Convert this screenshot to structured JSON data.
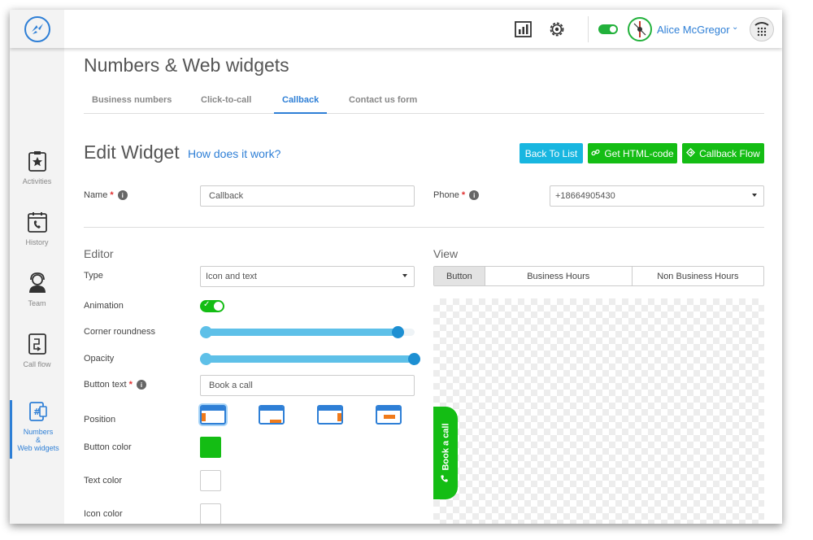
{
  "topbar": {
    "user_name": "Alice McGregor"
  },
  "sidebar": {
    "items": [
      {
        "label": "Activities"
      },
      {
        "label": "History"
      },
      {
        "label": "Team"
      },
      {
        "label": "Call flow"
      },
      {
        "label_line1": "Numbers",
        "label_line2": "&",
        "label_line3": "Web widgets"
      }
    ]
  },
  "page": {
    "title": "Numbers & Web widgets",
    "tabs": [
      {
        "label": "Business numbers"
      },
      {
        "label": "Click-to-call"
      },
      {
        "label": "Callback"
      },
      {
        "label": "Contact us form"
      }
    ],
    "active_tab": "Callback"
  },
  "edit": {
    "title": "Edit Widget",
    "help_link": "How does it work?",
    "back_button": "Back To List",
    "html_button": "Get HTML-code",
    "flow_button": "Callback Flow",
    "name_label": "Name",
    "name_value": "Callback",
    "phone_label": "Phone",
    "phone_value": "+18664905430",
    "required_mark": "*",
    "info_mark": "i"
  },
  "editor": {
    "title": "Editor",
    "type_label": "Type",
    "type_value": "Icon and text",
    "animation_label": "Animation",
    "animation_enabled": true,
    "corner_label": "Corner roundness",
    "corner_value": 0.92,
    "opacity_label": "Opacity",
    "opacity_value": 1.0,
    "button_text_label": "Button text",
    "button_text_value": "Book a call",
    "position_label": "Position",
    "position_selected": "left-middle",
    "button_color_label": "Button color",
    "button_color": "#14bd14",
    "text_color_label": "Text color",
    "text_color": "#ffffff",
    "icon_color_label": "Icon color",
    "icon_color": "#ffffff"
  },
  "view": {
    "title": "View",
    "tabs": [
      {
        "label": "Button"
      },
      {
        "label": "Business Hours"
      },
      {
        "label": "Non Business Hours"
      }
    ],
    "active_tab": "Button",
    "preview_button_text": "Book a call"
  },
  "colors": {
    "accent": "#2e7fd6",
    "green": "#14bd14",
    "cyan": "#18b6e0"
  }
}
